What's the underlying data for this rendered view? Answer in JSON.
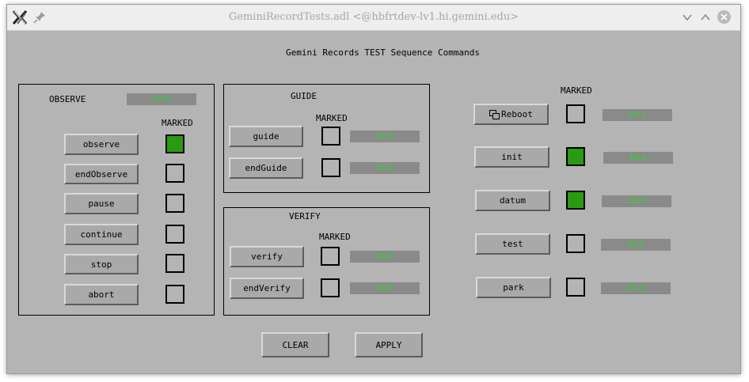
{
  "window": {
    "title": "GeminiRecordTests.adl  <@hbfrtdev-lv1.hi.gemini.edu>",
    "controls": [
      "minimize-chevron-icon",
      "maximize-chevron-icon",
      "close-icon"
    ]
  },
  "header": {
    "title": "Gemini Records TEST Sequence Commands"
  },
  "observe": {
    "title": "OBSERVE",
    "status": "IDLE",
    "marked_label": "MARKED",
    "rows": [
      {
        "label": "observe",
        "marked": true,
        "status": ""
      },
      {
        "label": "endObserve",
        "marked": false,
        "status": ""
      },
      {
        "label": "pause",
        "marked": false,
        "status": ""
      },
      {
        "label": "continue",
        "marked": false,
        "status": ""
      },
      {
        "label": "stop",
        "marked": false,
        "status": ""
      },
      {
        "label": "abort",
        "marked": false,
        "status": ""
      }
    ]
  },
  "guide": {
    "title": "GUIDE",
    "marked_label": "MARKED",
    "rows": [
      {
        "label": "guide",
        "marked": false,
        "status": "IDLE"
      },
      {
        "label": "endGuide",
        "marked": false,
        "status": "IDLE"
      }
    ]
  },
  "verify": {
    "title": "VERIFY",
    "marked_label": "MARKED",
    "rows": [
      {
        "label": "verify",
        "marked": false,
        "status": "IDLE"
      },
      {
        "label": "endVerify",
        "marked": false,
        "status": "IDLE"
      }
    ]
  },
  "system": {
    "marked_label": "MARKED",
    "rows": [
      {
        "label": "Reboot",
        "icon": "windows-icon",
        "marked": false,
        "status": "IDLE"
      },
      {
        "label": "init",
        "marked": true,
        "status": "IDLE"
      },
      {
        "label": "datum",
        "marked": true,
        "status": "IDLE"
      },
      {
        "label": "test",
        "marked": false,
        "status": "IDLE"
      },
      {
        "label": "park",
        "marked": false,
        "status": "IDLE"
      }
    ]
  },
  "footer": {
    "clear_label": "CLEAR",
    "apply_label": "APPLY"
  },
  "colors": {
    "background": "#b4b4b4",
    "button": "#a9a9a9",
    "marked_on": "#2a9a12",
    "status_bg": "#8a8a8a",
    "status_text": "#2fd52f"
  }
}
